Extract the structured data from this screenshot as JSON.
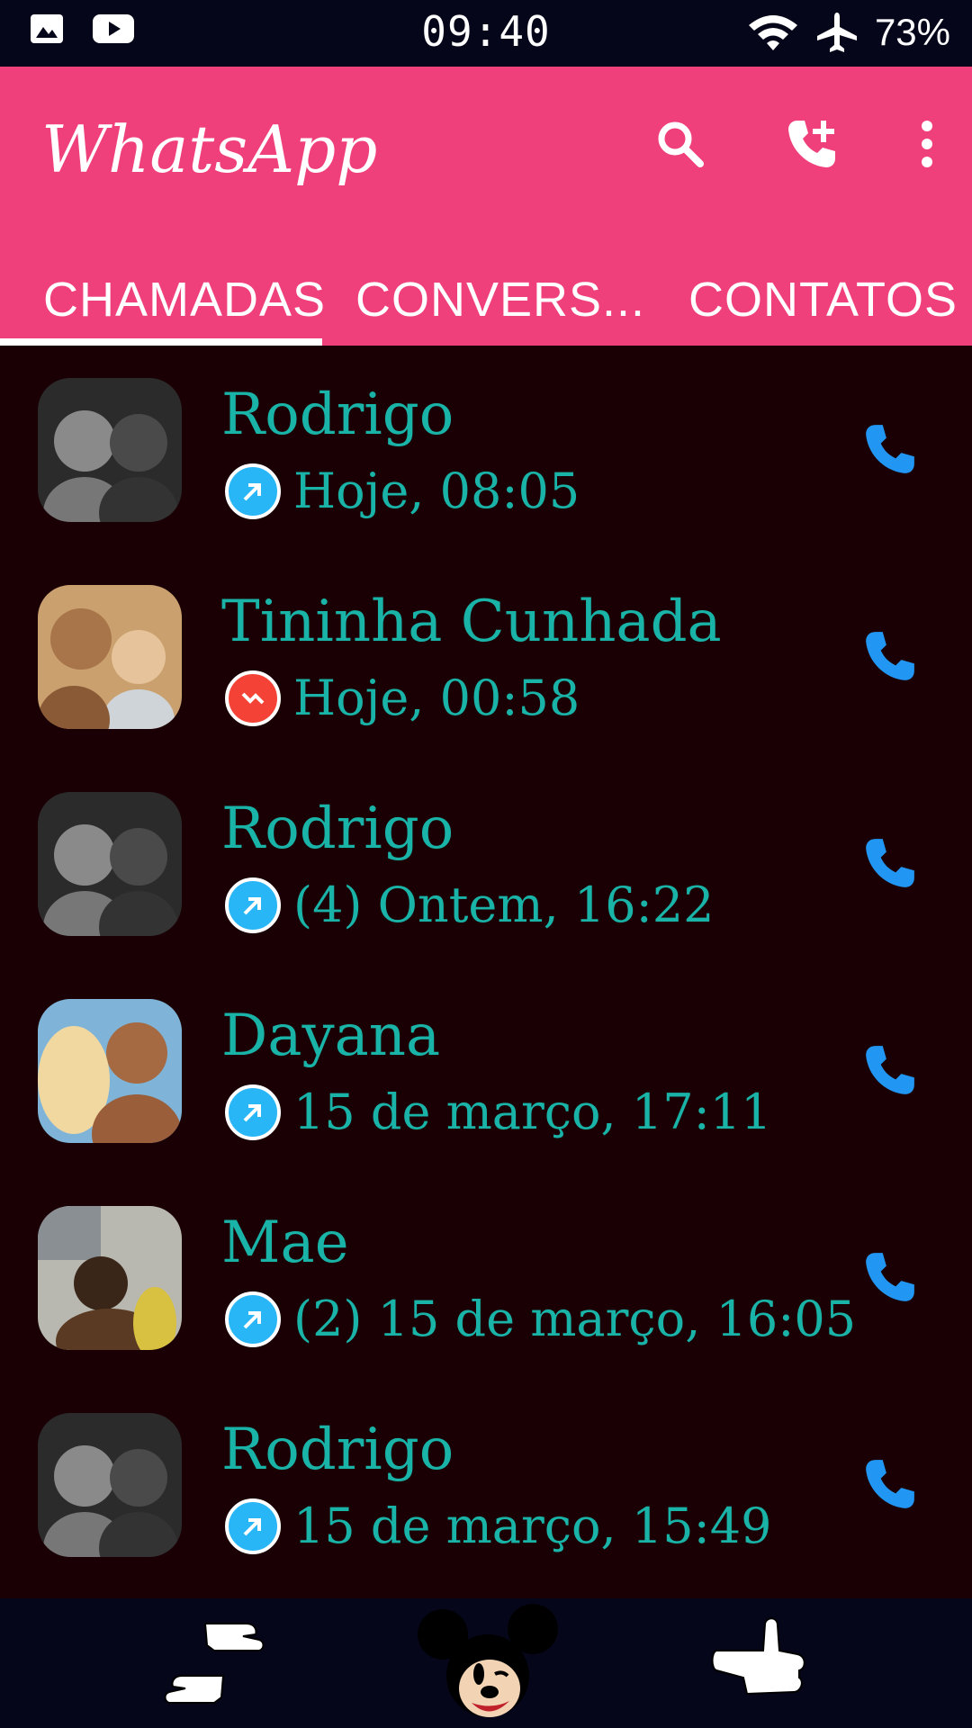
{
  "status_bar": {
    "time": "09:40",
    "battery": "73%",
    "icons": [
      "image-icon",
      "youtube-icon",
      "wifi-icon",
      "airplane-icon"
    ]
  },
  "app_bar": {
    "title": "WhatsApp",
    "actions": [
      "search-icon",
      "add-call-icon",
      "more-options-icon"
    ],
    "background_color": "#f0407c"
  },
  "tabs": [
    {
      "label": "CHAMADAS",
      "active": true
    },
    {
      "label": "CONVERS...",
      "active": false
    },
    {
      "label": "CONTATOS",
      "active": false
    }
  ],
  "calls": [
    {
      "name": "Rodrigo",
      "time": "Hoje, 08:05",
      "type": "outgoing"
    },
    {
      "name": "Tininha Cunhada",
      "time": "Hoje, 00:58",
      "type": "missed"
    },
    {
      "name": "Rodrigo",
      "time": "(4) Ontem, 16:22",
      "type": "outgoing"
    },
    {
      "name": "Dayana",
      "time": "15 de março, 17:11",
      "type": "outgoing"
    },
    {
      "name": "Mae",
      "time": "(2) 15 de março, 16:05",
      "type": "outgoing"
    },
    {
      "name": "Rodrigo",
      "time": "15 de março, 15:49",
      "type": "outgoing"
    }
  ],
  "colors": {
    "text_accent": "#19b3a8",
    "call_icon": "#2196f3",
    "outgoing_badge": "#29b6f6",
    "missed_badge": "#f44336"
  },
  "bottom_bar": {
    "items": [
      "back-gesture-icon",
      "mickey-home-icon",
      "recent-gesture-icon"
    ]
  }
}
